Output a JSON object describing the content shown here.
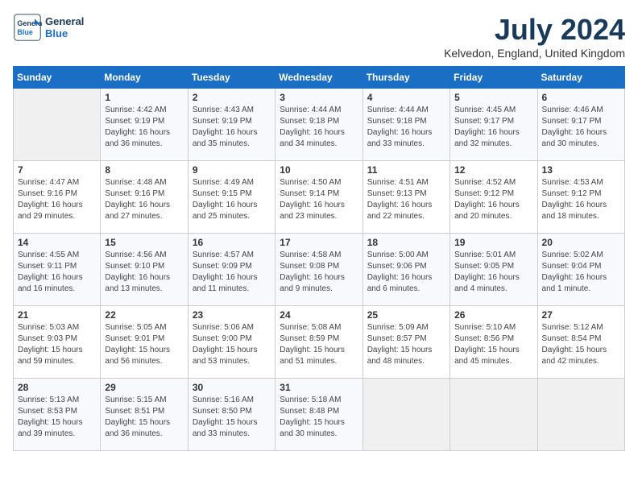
{
  "logo": {
    "line1": "General",
    "line2": "Blue"
  },
  "title": "July 2024",
  "location": "Kelvedon, England, United Kingdom",
  "days_header": [
    "Sunday",
    "Monday",
    "Tuesday",
    "Wednesday",
    "Thursday",
    "Friday",
    "Saturday"
  ],
  "weeks": [
    [
      {
        "num": "",
        "sunrise": "",
        "sunset": "",
        "daylight": ""
      },
      {
        "num": "1",
        "sunrise": "Sunrise: 4:42 AM",
        "sunset": "Sunset: 9:19 PM",
        "daylight": "Daylight: 16 hours and 36 minutes."
      },
      {
        "num": "2",
        "sunrise": "Sunrise: 4:43 AM",
        "sunset": "Sunset: 9:19 PM",
        "daylight": "Daylight: 16 hours and 35 minutes."
      },
      {
        "num": "3",
        "sunrise": "Sunrise: 4:44 AM",
        "sunset": "Sunset: 9:18 PM",
        "daylight": "Daylight: 16 hours and 34 minutes."
      },
      {
        "num": "4",
        "sunrise": "Sunrise: 4:44 AM",
        "sunset": "Sunset: 9:18 PM",
        "daylight": "Daylight: 16 hours and 33 minutes."
      },
      {
        "num": "5",
        "sunrise": "Sunrise: 4:45 AM",
        "sunset": "Sunset: 9:17 PM",
        "daylight": "Daylight: 16 hours and 32 minutes."
      },
      {
        "num": "6",
        "sunrise": "Sunrise: 4:46 AM",
        "sunset": "Sunset: 9:17 PM",
        "daylight": "Daylight: 16 hours and 30 minutes."
      }
    ],
    [
      {
        "num": "7",
        "sunrise": "Sunrise: 4:47 AM",
        "sunset": "Sunset: 9:16 PM",
        "daylight": "Daylight: 16 hours and 29 minutes."
      },
      {
        "num": "8",
        "sunrise": "Sunrise: 4:48 AM",
        "sunset": "Sunset: 9:16 PM",
        "daylight": "Daylight: 16 hours and 27 minutes."
      },
      {
        "num": "9",
        "sunrise": "Sunrise: 4:49 AM",
        "sunset": "Sunset: 9:15 PM",
        "daylight": "Daylight: 16 hours and 25 minutes."
      },
      {
        "num": "10",
        "sunrise": "Sunrise: 4:50 AM",
        "sunset": "Sunset: 9:14 PM",
        "daylight": "Daylight: 16 hours and 23 minutes."
      },
      {
        "num": "11",
        "sunrise": "Sunrise: 4:51 AM",
        "sunset": "Sunset: 9:13 PM",
        "daylight": "Daylight: 16 hours and 22 minutes."
      },
      {
        "num": "12",
        "sunrise": "Sunrise: 4:52 AM",
        "sunset": "Sunset: 9:12 PM",
        "daylight": "Daylight: 16 hours and 20 minutes."
      },
      {
        "num": "13",
        "sunrise": "Sunrise: 4:53 AM",
        "sunset": "Sunset: 9:12 PM",
        "daylight": "Daylight: 16 hours and 18 minutes."
      }
    ],
    [
      {
        "num": "14",
        "sunrise": "Sunrise: 4:55 AM",
        "sunset": "Sunset: 9:11 PM",
        "daylight": "Daylight: 16 hours and 16 minutes."
      },
      {
        "num": "15",
        "sunrise": "Sunrise: 4:56 AM",
        "sunset": "Sunset: 9:10 PM",
        "daylight": "Daylight: 16 hours and 13 minutes."
      },
      {
        "num": "16",
        "sunrise": "Sunrise: 4:57 AM",
        "sunset": "Sunset: 9:09 PM",
        "daylight": "Daylight: 16 hours and 11 minutes."
      },
      {
        "num": "17",
        "sunrise": "Sunrise: 4:58 AM",
        "sunset": "Sunset: 9:08 PM",
        "daylight": "Daylight: 16 hours and 9 minutes."
      },
      {
        "num": "18",
        "sunrise": "Sunrise: 5:00 AM",
        "sunset": "Sunset: 9:06 PM",
        "daylight": "Daylight: 16 hours and 6 minutes."
      },
      {
        "num": "19",
        "sunrise": "Sunrise: 5:01 AM",
        "sunset": "Sunset: 9:05 PM",
        "daylight": "Daylight: 16 hours and 4 minutes."
      },
      {
        "num": "20",
        "sunrise": "Sunrise: 5:02 AM",
        "sunset": "Sunset: 9:04 PM",
        "daylight": "Daylight: 16 hours and 1 minute."
      }
    ],
    [
      {
        "num": "21",
        "sunrise": "Sunrise: 5:03 AM",
        "sunset": "Sunset: 9:03 PM",
        "daylight": "Daylight: 15 hours and 59 minutes."
      },
      {
        "num": "22",
        "sunrise": "Sunrise: 5:05 AM",
        "sunset": "Sunset: 9:01 PM",
        "daylight": "Daylight: 15 hours and 56 minutes."
      },
      {
        "num": "23",
        "sunrise": "Sunrise: 5:06 AM",
        "sunset": "Sunset: 9:00 PM",
        "daylight": "Daylight: 15 hours and 53 minutes."
      },
      {
        "num": "24",
        "sunrise": "Sunrise: 5:08 AM",
        "sunset": "Sunset: 8:59 PM",
        "daylight": "Daylight: 15 hours and 51 minutes."
      },
      {
        "num": "25",
        "sunrise": "Sunrise: 5:09 AM",
        "sunset": "Sunset: 8:57 PM",
        "daylight": "Daylight: 15 hours and 48 minutes."
      },
      {
        "num": "26",
        "sunrise": "Sunrise: 5:10 AM",
        "sunset": "Sunset: 8:56 PM",
        "daylight": "Daylight: 15 hours and 45 minutes."
      },
      {
        "num": "27",
        "sunrise": "Sunrise: 5:12 AM",
        "sunset": "Sunset: 8:54 PM",
        "daylight": "Daylight: 15 hours and 42 minutes."
      }
    ],
    [
      {
        "num": "28",
        "sunrise": "Sunrise: 5:13 AM",
        "sunset": "Sunset: 8:53 PM",
        "daylight": "Daylight: 15 hours and 39 minutes."
      },
      {
        "num": "29",
        "sunrise": "Sunrise: 5:15 AM",
        "sunset": "Sunset: 8:51 PM",
        "daylight": "Daylight: 15 hours and 36 minutes."
      },
      {
        "num": "30",
        "sunrise": "Sunrise: 5:16 AM",
        "sunset": "Sunset: 8:50 PM",
        "daylight": "Daylight: 15 hours and 33 minutes."
      },
      {
        "num": "31",
        "sunrise": "Sunrise: 5:18 AM",
        "sunset": "Sunset: 8:48 PM",
        "daylight": "Daylight: 15 hours and 30 minutes."
      },
      {
        "num": "",
        "sunrise": "",
        "sunset": "",
        "daylight": ""
      },
      {
        "num": "",
        "sunrise": "",
        "sunset": "",
        "daylight": ""
      },
      {
        "num": "",
        "sunrise": "",
        "sunset": "",
        "daylight": ""
      }
    ]
  ]
}
